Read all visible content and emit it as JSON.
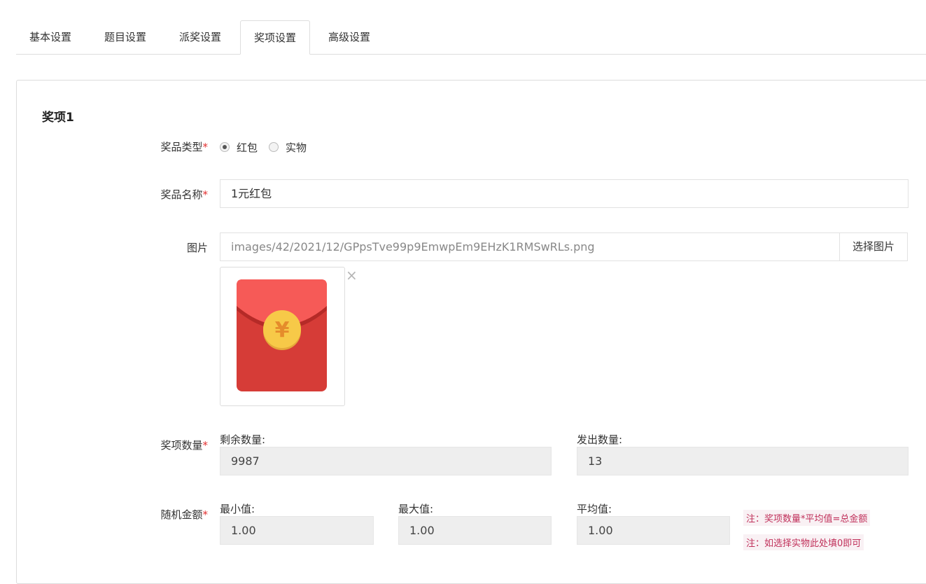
{
  "tabs": [
    {
      "label": "基本设置",
      "active": false
    },
    {
      "label": "题目设置",
      "active": false
    },
    {
      "label": "派奖设置",
      "active": false
    },
    {
      "label": "奖项设置",
      "active": true
    },
    {
      "label": "高级设置",
      "active": false
    }
  ],
  "section": {
    "title": "奖项1"
  },
  "form": {
    "prize_type": {
      "label": "奖品类型",
      "required_mark": "*",
      "options": [
        {
          "label": "红包",
          "checked": true
        },
        {
          "label": "实物",
          "checked": false
        }
      ]
    },
    "prize_name": {
      "label": "奖品名称",
      "required_mark": "*",
      "value": "1元红包"
    },
    "image": {
      "label": "图片",
      "value": "images/42/2021/12/GPpsTve99p9EmwpEm9EHzK1RMSwRLs.png",
      "select_label": "选择图片",
      "remove_glyph": "×",
      "icon": "red-envelope-icon",
      "coin_glyph": "¥"
    },
    "quantity": {
      "label": "奖项数量",
      "required_mark": "*",
      "remaining_label": "剩余数量:",
      "remaining_value": "9987",
      "issued_label": "发出数量:",
      "issued_value": "13"
    },
    "random_amount": {
      "label": "随机金额",
      "required_mark": "*",
      "min_label": "最小值:",
      "min_value": "1.00",
      "max_label": "最大值:",
      "max_value": "1.00",
      "avg_label": "平均值:",
      "avg_value": "1.00",
      "note1": "注：奖项数量*平均值=总金额",
      "note2": "注：如选择实物此处填0即可"
    }
  },
  "colors": {
    "required": "#e23030",
    "note_text": "#c0305a",
    "envelope_top": "#f65a57",
    "envelope_body": "#d63c37",
    "coin": "#f7c948"
  }
}
